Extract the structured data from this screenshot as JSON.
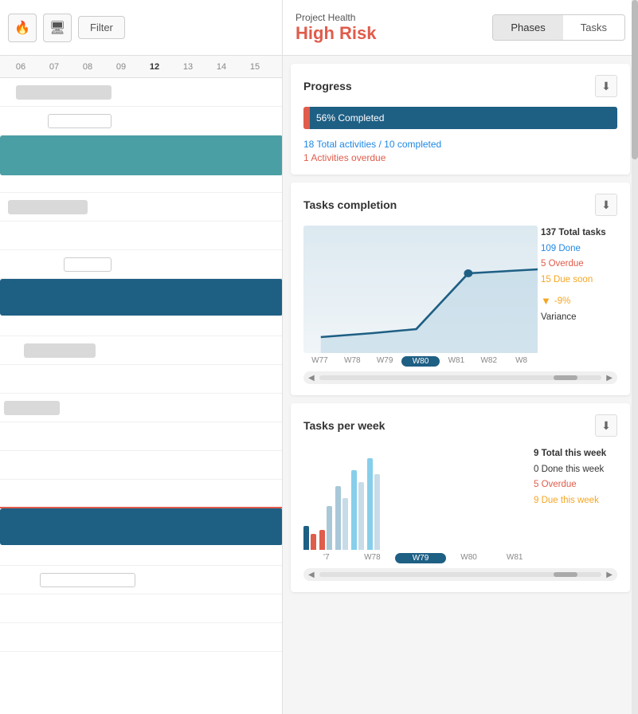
{
  "toolbar": {
    "filter_label": "Filter",
    "flame_icon": "🔥",
    "monitor_icon": "🖥"
  },
  "timeline": {
    "weeks": [
      "06",
      "07",
      "08",
      "09",
      "12",
      "13",
      "14",
      "15"
    ]
  },
  "project_health": {
    "label": "Project Health",
    "status": "High Risk",
    "tabs": [
      "Phases",
      "Tasks"
    ]
  },
  "progress": {
    "title": "Progress",
    "bar_label": "56% Completed",
    "total_activities": "18 Total activities / 10 completed",
    "overdue": "1 Activities overdue"
  },
  "tasks_completion": {
    "title": "Tasks completion",
    "total_tasks": "137 Total tasks",
    "done": "109 Done",
    "overdue": "5 Overdue",
    "due_soon": "15 Due soon",
    "variance_pct": "-9%",
    "variance_label": "Variance",
    "weeks": [
      "W77",
      "W78",
      "W79",
      "W80",
      "W81",
      "W82",
      "W8"
    ]
  },
  "tasks_per_week": {
    "title": "Tasks per week",
    "total_this_week": "9 Total this week",
    "done_this_week": "0 Done this week",
    "overdue": "5 Overdue",
    "due_this_week": "9 Due this week",
    "weeks": [
      "'7",
      "W78",
      "W79",
      "W80",
      "W81"
    ]
  }
}
